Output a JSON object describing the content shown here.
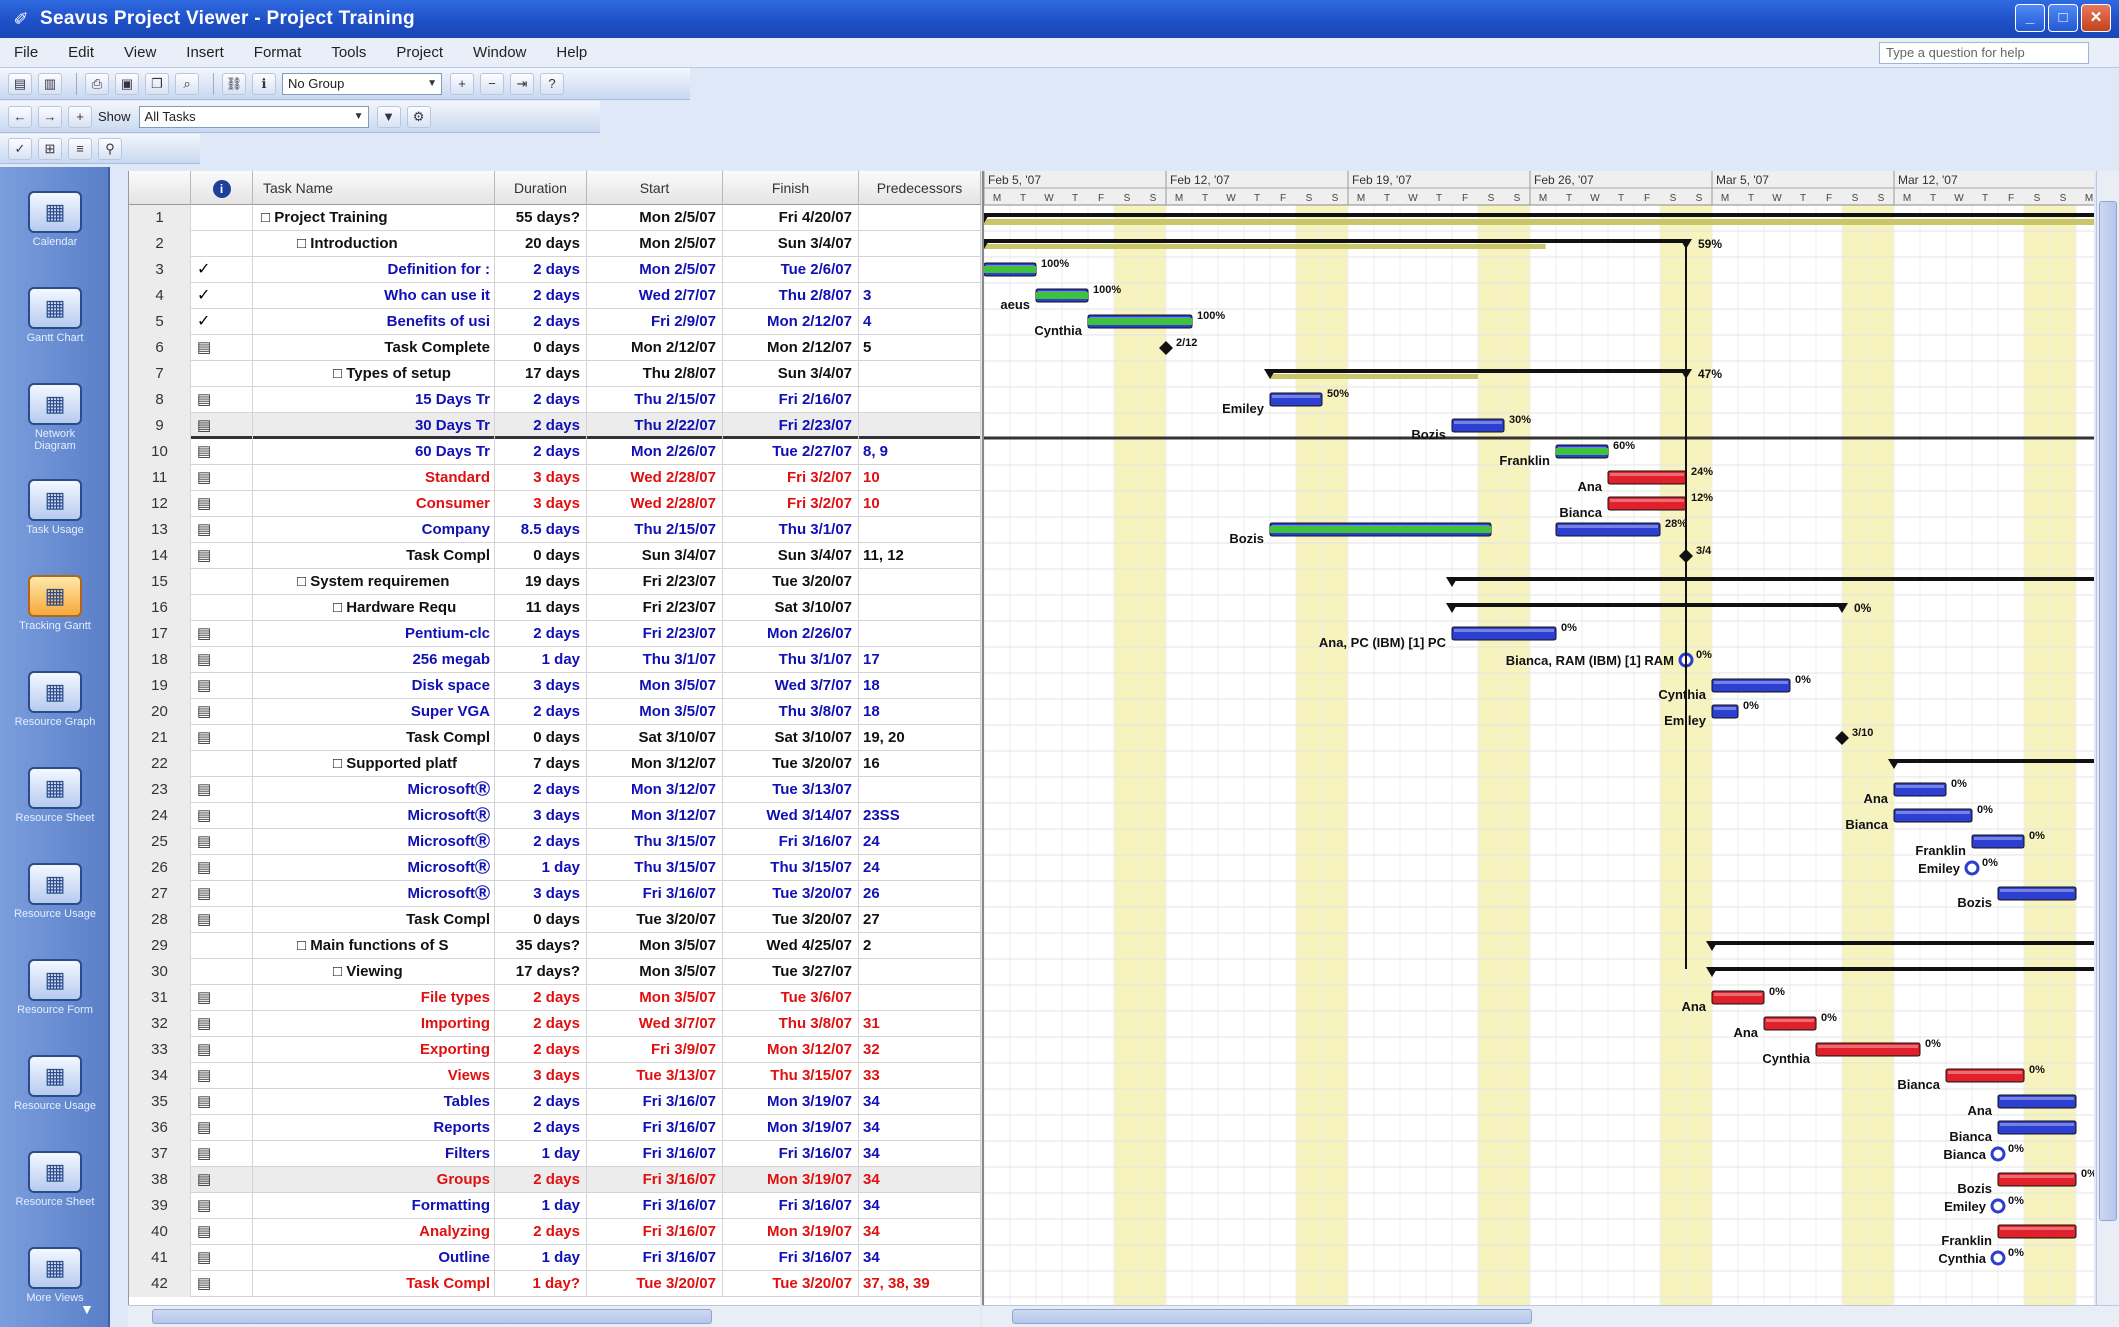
{
  "window": {
    "title": "Seavus Project Viewer - Project Training",
    "buttons": [
      "_",
      "□",
      "✕"
    ]
  },
  "menu": {
    "items": [
      "File",
      "Edit",
      "View",
      "Insert",
      "Format",
      "Tools",
      "Project",
      "Window",
      "Help"
    ],
    "help_placeholder": "Type a question for help"
  },
  "toolbar1": {
    "group_select": "No Group"
  },
  "toolbar2": {
    "show_label": "Show",
    "filter_select": "All Tasks"
  },
  "viewbar": {
    "items": [
      {
        "label": "Calendar",
        "icon": "calendar-icon"
      },
      {
        "label": "Gantt Chart",
        "icon": "gantt-icon"
      },
      {
        "label": "Network Diagram",
        "icon": "network-icon"
      },
      {
        "label": "Task Usage",
        "icon": "task-usage-icon"
      },
      {
        "label": "Tracking Gantt",
        "icon": "tracking-gantt-icon"
      },
      {
        "label": "Resource Graph",
        "icon": "resource-graph-icon"
      },
      {
        "label": "Resource Sheet",
        "icon": "resource-sheet-icon"
      },
      {
        "label": "Resource Usage",
        "icon": "resource-usage-icon"
      },
      {
        "label": "Resource Form",
        "icon": "resource-form-icon"
      },
      {
        "label": "Resource Usage",
        "icon": "resource-usage-icon"
      },
      {
        "label": "Resource Sheet",
        "icon": "resource-sheet2-icon"
      },
      {
        "label": "More Views",
        "icon": "more-views-icon"
      }
    ],
    "active_index": 4
  },
  "table": {
    "headers": [
      "",
      "i",
      "Task Name",
      "Duration",
      "Start",
      "Finish",
      "Predecessors"
    ],
    "rows": [
      {
        "id": "1",
        "ind": "",
        "name": "□ Project Training",
        "dur": "55 days?",
        "start": "Mon 2/5/07",
        "fin": "Fri 4/20/07",
        "pred": "",
        "color": "black",
        "indent": 0
      },
      {
        "id": "2",
        "ind": "",
        "name": "□ Introduction",
        "dur": "20 days",
        "start": "Mon 2/5/07",
        "fin": "Sun 3/4/07",
        "pred": "",
        "color": "black",
        "indent": 1
      },
      {
        "id": "3",
        "ind": "✓",
        "name": "Definition for :",
        "dur": "2 days",
        "start": "Mon 2/5/07",
        "fin": "Tue 2/6/07",
        "pred": "",
        "color": "blue",
        "indent": 3
      },
      {
        "id": "4",
        "ind": "✓",
        "name": "Who can use it",
        "dur": "2 days",
        "start": "Wed 2/7/07",
        "fin": "Thu 2/8/07",
        "pred": "3",
        "color": "blue",
        "indent": 3
      },
      {
        "id": "5",
        "ind": "✓",
        "name": "Benefits of usi",
        "dur": "2 days",
        "start": "Fri 2/9/07",
        "fin": "Mon 2/12/07",
        "pred": "4",
        "color": "blue",
        "indent": 3
      },
      {
        "id": "6",
        "ind": "▤",
        "name": "Task Complete",
        "dur": "0 days",
        "start": "Mon 2/12/07",
        "fin": "Mon 2/12/07",
        "pred": "5",
        "color": "black",
        "indent": 3
      },
      {
        "id": "7",
        "ind": "",
        "name": "□ Types of setup",
        "dur": "17 days",
        "start": "Thu 2/8/07",
        "fin": "Sun 3/4/07",
        "pred": "",
        "color": "black",
        "indent": 2
      },
      {
        "id": "8",
        "ind": "▤",
        "name": "15 Days Tr",
        "dur": "2 days",
        "start": "Thu 2/15/07",
        "fin": "Fri 2/16/07",
        "pred": "",
        "color": "blue",
        "indent": 4
      },
      {
        "id": "9",
        "ind": "▤",
        "name": "30 Days Tr",
        "dur": "2 days",
        "start": "Thu 2/22/07",
        "fin": "Fri 2/23/07",
        "pred": "",
        "color": "blue",
        "indent": 4
      },
      {
        "id": "10",
        "ind": "▤",
        "name": "60 Days Tr",
        "dur": "2 days",
        "start": "Mon 2/26/07",
        "fin": "Tue 2/27/07",
        "pred": "8, 9",
        "color": "blue",
        "indent": 4
      },
      {
        "id": "11",
        "ind": "▤",
        "name": "Standard",
        "dur": "3 days",
        "start": "Wed 2/28/07",
        "fin": "Fri 3/2/07",
        "pred": "10",
        "color": "red",
        "indent": 4
      },
      {
        "id": "12",
        "ind": "▤",
        "name": "Consumer",
        "dur": "3 days",
        "start": "Wed 2/28/07",
        "fin": "Fri 3/2/07",
        "pred": "10",
        "color": "red",
        "indent": 4
      },
      {
        "id": "13",
        "ind": "▤",
        "name": "Company",
        "dur": "8.5 days",
        "start": "Thu 2/15/07",
        "fin": "Thu 3/1/07",
        "pred": "",
        "color": "blue",
        "indent": 4
      },
      {
        "id": "14",
        "ind": "▤",
        "name": "Task Compl",
        "dur": "0 days",
        "start": "Sun 3/4/07",
        "fin": "Sun 3/4/07",
        "pred": "11, 12",
        "color": "black",
        "indent": 4
      },
      {
        "id": "15",
        "ind": "",
        "name": "□ System requiremen",
        "dur": "19 days",
        "start": "Fri 2/23/07",
        "fin": "Tue 3/20/07",
        "pred": "",
        "color": "black",
        "indent": 1
      },
      {
        "id": "16",
        "ind": "",
        "name": "□ Hardware Requ",
        "dur": "11 days",
        "start": "Fri 2/23/07",
        "fin": "Sat 3/10/07",
        "pred": "",
        "color": "black",
        "indent": 2
      },
      {
        "id": "17",
        "ind": "▤",
        "name": "Pentium-clc",
        "dur": "2 days",
        "start": "Fri 2/23/07",
        "fin": "Mon 2/26/07",
        "pred": "",
        "color": "blue",
        "indent": 4
      },
      {
        "id": "18",
        "ind": "▤",
        "name": "256 megab",
        "dur": "1 day",
        "start": "Thu 3/1/07",
        "fin": "Thu 3/1/07",
        "pred": "17",
        "color": "blue",
        "indent": 4
      },
      {
        "id": "19",
        "ind": "▤",
        "name": "Disk space",
        "dur": "3 days",
        "start": "Mon 3/5/07",
        "fin": "Wed 3/7/07",
        "pred": "18",
        "color": "blue",
        "indent": 4
      },
      {
        "id": "20",
        "ind": "▤",
        "name": "Super VGA",
        "dur": "2 days",
        "start": "Mon 3/5/07",
        "fin": "Thu 3/8/07",
        "pred": "18",
        "color": "blue",
        "indent": 4
      },
      {
        "id": "21",
        "ind": "▤",
        "name": "Task Compl",
        "dur": "0 days",
        "start": "Sat 3/10/07",
        "fin": "Sat 3/10/07",
        "pred": "19, 20",
        "color": "black",
        "indent": 4
      },
      {
        "id": "22",
        "ind": "",
        "name": "□ Supported platf",
        "dur": "7 days",
        "start": "Mon 3/12/07",
        "fin": "Tue 3/20/07",
        "pred": "16",
        "color": "black",
        "indent": 2
      },
      {
        "id": "23",
        "ind": "▤",
        "name": "MicrosoftⓇ",
        "dur": "2 days",
        "start": "Mon 3/12/07",
        "fin": "Tue 3/13/07",
        "pred": "",
        "color": "blue",
        "indent": 4
      },
      {
        "id": "24",
        "ind": "▤",
        "name": "MicrosoftⓇ",
        "dur": "3 days",
        "start": "Mon 3/12/07",
        "fin": "Wed 3/14/07",
        "pred": "23SS",
        "color": "blue",
        "indent": 4
      },
      {
        "id": "25",
        "ind": "▤",
        "name": "MicrosoftⓇ",
        "dur": "2 days",
        "start": "Thu 3/15/07",
        "fin": "Fri 3/16/07",
        "pred": "24",
        "color": "blue",
        "indent": 4
      },
      {
        "id": "26",
        "ind": "▤",
        "name": "MicrosoftⓇ",
        "dur": "1 day",
        "start": "Thu 3/15/07",
        "fin": "Thu 3/15/07",
        "pred": "24",
        "color": "blue",
        "indent": 4
      },
      {
        "id": "27",
        "ind": "▤",
        "name": "MicrosoftⓇ",
        "dur": "3 days",
        "start": "Fri 3/16/07",
        "fin": "Tue 3/20/07",
        "pred": "26",
        "color": "blue",
        "indent": 4
      },
      {
        "id": "28",
        "ind": "▤",
        "name": "Task Compl",
        "dur": "0 days",
        "start": "Tue 3/20/07",
        "fin": "Tue 3/20/07",
        "pred": "27",
        "color": "black",
        "indent": 4
      },
      {
        "id": "29",
        "ind": "",
        "name": "□ Main functions of S",
        "dur": "35 days?",
        "start": "Mon 3/5/07",
        "fin": "Wed 4/25/07",
        "pred": "2",
        "color": "black",
        "indent": 1
      },
      {
        "id": "30",
        "ind": "",
        "name": "□ Viewing",
        "dur": "17 days?",
        "start": "Mon 3/5/07",
        "fin": "Tue 3/27/07",
        "pred": "",
        "color": "black",
        "indent": 2
      },
      {
        "id": "31",
        "ind": "▤",
        "name": "File types",
        "dur": "2 days",
        "start": "Mon 3/5/07",
        "fin": "Tue 3/6/07",
        "pred": "",
        "color": "red",
        "indent": 4
      },
      {
        "id": "32",
        "ind": "▤",
        "name": "Importing",
        "dur": "2 days",
        "start": "Wed 3/7/07",
        "fin": "Thu 3/8/07",
        "pred": "31",
        "color": "red",
        "indent": 4
      },
      {
        "id": "33",
        "ind": "▤",
        "name": "Exporting",
        "dur": "2 days",
        "start": "Fri 3/9/07",
        "fin": "Mon 3/12/07",
        "pred": "32",
        "color": "red",
        "indent": 4
      },
      {
        "id": "34",
        "ind": "▤",
        "name": "Views",
        "dur": "3 days",
        "start": "Tue 3/13/07",
        "fin": "Thu 3/15/07",
        "pred": "33",
        "color": "red",
        "indent": 4
      },
      {
        "id": "35",
        "ind": "▤",
        "name": "Tables",
        "dur": "2 days",
        "start": "Fri 3/16/07",
        "fin": "Mon 3/19/07",
        "pred": "34",
        "color": "blue",
        "indent": 4
      },
      {
        "id": "36",
        "ind": "▤",
        "name": "Reports",
        "dur": "2 days",
        "start": "Fri 3/16/07",
        "fin": "Mon 3/19/07",
        "pred": "34",
        "color": "blue",
        "indent": 4
      },
      {
        "id": "37",
        "ind": "▤",
        "name": "Filters",
        "dur": "1 day",
        "start": "Fri 3/16/07",
        "fin": "Fri 3/16/07",
        "pred": "34",
        "color": "blue",
        "indent": 4
      },
      {
        "id": "38",
        "ind": "▤",
        "name": "Groups",
        "dur": "2 days",
        "start": "Fri 3/16/07",
        "fin": "Mon 3/19/07",
        "pred": "34",
        "color": "red",
        "indent": 4
      },
      {
        "id": "39",
        "ind": "▤",
        "name": "Formatting",
        "dur": "1 day",
        "start": "Fri 3/16/07",
        "fin": "Fri 3/16/07",
        "pred": "34",
        "color": "blue",
        "indent": 4
      },
      {
        "id": "40",
        "ind": "▤",
        "name": "Analyzing",
        "dur": "2 days",
        "start": "Fri 3/16/07",
        "fin": "Mon 3/19/07",
        "pred": "34",
        "color": "red",
        "indent": 4
      },
      {
        "id": "41",
        "ind": "▤",
        "name": "Outline",
        "dur": "1 day",
        "start": "Fri 3/16/07",
        "fin": "Fri 3/16/07",
        "pred": "34",
        "color": "blue",
        "indent": 4
      },
      {
        "id": "42",
        "ind": "▤",
        "name": "Task Compl",
        "dur": "1 day?",
        "start": "Tue 3/20/07",
        "fin": "Tue 3/20/07",
        "pred": "37, 38, 39",
        "color": "red",
        "indent": 4
      }
    ],
    "selected_row": "9"
  },
  "gantt": {
    "weeks": [
      "Feb 5, '07",
      "Feb 12, '07",
      "Feb 19, '07",
      "Feb 26, '07",
      "Mar 5, '07",
      "Mar 12, '07"
    ],
    "days": [
      "M",
      "T",
      "W",
      "T",
      "F",
      "S",
      "S"
    ],
    "colors": {
      "blue": "#2c3fd0",
      "green": "#3ec23e",
      "red": "#e0202a",
      "summary": "#c9c56a",
      "weekend": "#f7f3bf"
    },
    "bars": [
      {
        "row": 3,
        "start": 0,
        "dur": 2,
        "color": "blue",
        "pct": 1.0,
        "label": "100%",
        "res": ""
      },
      {
        "row": 4,
        "start": 2,
        "dur": 2,
        "color": "blue",
        "pct": 1.0,
        "label": "100%",
        "res": "aeus"
      },
      {
        "row": 5,
        "start": 4,
        "dur": 4,
        "color": "blue",
        "pct": 1.0,
        "label": "100%",
        "res": "Cynthia"
      },
      {
        "row": 8,
        "start": 11,
        "dur": 2,
        "color": "blue",
        "pct": 0.0,
        "label": "50%",
        "res": "Emiley"
      },
      {
        "row": 9,
        "start": 18,
        "dur": 2,
        "color": "blue",
        "pct": 0.0,
        "label": "30%",
        "res": "Bozis"
      },
      {
        "row": 10,
        "start": 22,
        "dur": 2,
        "color": "blue",
        "pct": 1.0,
        "label": "60%",
        "res": "Franklin"
      },
      {
        "row": 11,
        "start": 24,
        "dur": 3,
        "color": "red",
        "pct": 0.0,
        "label": "24%",
        "res": "Ana"
      },
      {
        "row": 12,
        "start": 24,
        "dur": 3,
        "color": "red",
        "pct": 0.0,
        "label": "12%",
        "res": "Bianca"
      },
      {
        "row": 13,
        "start": 11,
        "dur": 8.5,
        "color": "blue",
        "pct": 1.0,
        "label": "",
        "res": "Bozis"
      },
      {
        "row": 13,
        "start": 22,
        "dur": 4,
        "color": "blue",
        "pct": 0.0,
        "label": "28%",
        "res": ""
      },
      {
        "row": 17,
        "start": 18,
        "dur": 4,
        "color": "blue",
        "pct": 0.0,
        "label": "0%",
        "res": "Ana, PC (IBM) [1] PC"
      },
      {
        "row": 19,
        "start": 28,
        "dur": 3,
        "color": "blue",
        "pct": 0.0,
        "label": "0%",
        "res": "Cynthia"
      },
      {
        "row": 20,
        "start": 28,
        "dur": 1,
        "color": "blue",
        "pct": 0.0,
        "label": "0%",
        "res": "Emiley"
      },
      {
        "row": 23,
        "start": 35,
        "dur": 2,
        "color": "blue",
        "pct": 0.0,
        "label": "0%",
        "res": "Ana"
      },
      {
        "row": 24,
        "start": 35,
        "dur": 3,
        "color": "blue",
        "pct": 0.0,
        "label": "0%",
        "res": "Bianca"
      },
      {
        "row": 25,
        "start": 38,
        "dur": 2,
        "color": "blue",
        "pct": 0.0,
        "label": "0%",
        "res": "Franklin"
      },
      {
        "row": 27,
        "start": 39,
        "dur": 3,
        "color": "blue",
        "pct": 0.0,
        "label": "",
        "res": "Bozis"
      },
      {
        "row": 31,
        "start": 28,
        "dur": 2,
        "color": "red",
        "pct": 0.0,
        "label": "0%",
        "res": "Ana"
      },
      {
        "row": 32,
        "start": 30,
        "dur": 2,
        "color": "red",
        "pct": 0.0,
        "label": "0%",
        "res": "Ana"
      },
      {
        "row": 33,
        "start": 32,
        "dur": 4,
        "color": "red",
        "pct": 0.0,
        "label": "0%",
        "res": "Cynthia"
      },
      {
        "row": 34,
        "start": 37,
        "dur": 3,
        "color": "red",
        "pct": 0.0,
        "label": "0%",
        "res": "Bianca"
      },
      {
        "row": 35,
        "start": 39,
        "dur": 3,
        "color": "blue",
        "pct": 0.0,
        "label": "",
        "res": "Ana"
      },
      {
        "row": 36,
        "start": 39,
        "dur": 3,
        "color": "blue",
        "pct": 0.0,
        "label": "",
        "res": "Bianca"
      },
      {
        "row": 38,
        "start": 39,
        "dur": 3,
        "color": "red",
        "pct": 0.0,
        "label": "0%",
        "res": "Bozis"
      },
      {
        "row": 40,
        "start": 39,
        "dur": 3,
        "color": "red",
        "pct": 0.0,
        "label": "",
        "res": "Franklin"
      }
    ],
    "milestones": [
      {
        "row": 18,
        "day": 27,
        "label": "0%",
        "res": "Bianca, RAM (IBM) [1] RAM",
        "style": "circle"
      },
      {
        "row": 26,
        "day": 38,
        "label": "0%",
        "res": "Emiley",
        "style": "circle"
      },
      {
        "row": 37,
        "day": 39,
        "label": "0%",
        "res": "Bianca",
        "style": "circle"
      },
      {
        "row": 39,
        "day": 39,
        "label": "0%",
        "res": "Emiley",
        "style": "circle"
      },
      {
        "row": 41,
        "day": 39,
        "label": "0%",
        "res": "Cynthia",
        "style": "circle"
      },
      {
        "row": 6,
        "day": 7,
        "label": "2/12",
        "res": "",
        "style": "diamond"
      },
      {
        "row": 14,
        "day": 27,
        "label": "3/4",
        "res": "",
        "style": "diamond"
      },
      {
        "row": 21,
        "day": 33,
        "label": "3/10",
        "res": "",
        "style": "diamond"
      }
    ],
    "summaries": [
      {
        "row": 1,
        "start": 0,
        "end": 60,
        "label": "",
        "pct": 0.35
      },
      {
        "row": 2,
        "start": 0,
        "end": 27,
        "label": "59%",
        "pct": 0.8
      },
      {
        "row": 7,
        "start": 11,
        "end": 27,
        "label": "47%",
        "pct": 0.5
      },
      {
        "row": 15,
        "start": 18,
        "end": 60,
        "label": "",
        "pct": 0.0
      },
      {
        "row": 16,
        "start": 18,
        "end": 33,
        "label": "0%",
        "pct": 0.0
      },
      {
        "row": 22,
        "start": 35,
        "end": 60,
        "label": "",
        "pct": 0.0
      },
      {
        "row": 29,
        "start": 28,
        "end": 60,
        "label": "",
        "pct": 0.0
      },
      {
        "row": 30,
        "start": 28,
        "end": 60,
        "label": "",
        "pct": 0.0
      }
    ]
  }
}
